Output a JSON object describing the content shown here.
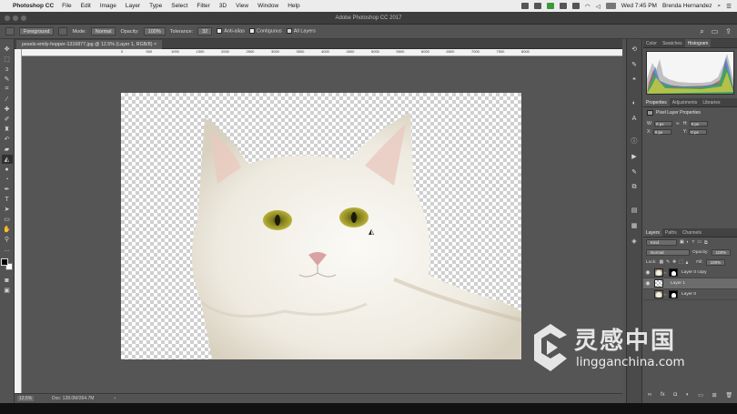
{
  "menubar": {
    "app_name": "Photoshop CC",
    "items": [
      "File",
      "Edit",
      "Image",
      "Layer",
      "Type",
      "Select",
      "Filter",
      "3D",
      "View",
      "Window",
      "Help"
    ],
    "clock": "Wed 7:45 PM",
    "user": "Brenda Hernandez"
  },
  "titlebar": {
    "title": "Adobe Photoshop CC 2017"
  },
  "options": {
    "source": "Foreground",
    "mode_label": "Mode:",
    "mode": "Normal",
    "opacity_label": "Opacity:",
    "opacity": "100%",
    "tolerance_label": "Tolerance:",
    "tolerance": "32",
    "antialias": "Anti-alias",
    "contiguous": "Contiguous",
    "all_layers": "All Layers"
  },
  "document": {
    "tab_title": "pexels-emily-hopper-1316877.jpg @ 12.5% (Layer 1, RGB/8)",
    "ruler_ticks": [
      "0",
      "500",
      "1000",
      "1500",
      "2000",
      "2500",
      "3000",
      "3500",
      "4000",
      "4500",
      "5000",
      "5500",
      "6000",
      "6500",
      "7000",
      "7500",
      "8000"
    ]
  },
  "status": {
    "zoom": "12.5%",
    "doc": "Doc: 128.0M/264.7M"
  },
  "panels": {
    "top_tabs": [
      "Color",
      "Swatches",
      "Histogram"
    ],
    "props_tabs": [
      "Properties",
      "Adjustments",
      "Libraries"
    ],
    "props_title": "Pixel Layer Properties",
    "w_label": "W:",
    "w": "0 px",
    "h_label": "H:",
    "h": "0 px",
    "x_label": "X:",
    "x": "0 px",
    "y_label": "Y:",
    "y": "0 px",
    "layers_tabs": [
      "Layers",
      "Paths",
      "Channels"
    ],
    "kind": "Kind",
    "blend": "Normal",
    "opacity_label": "Opacity:",
    "opacity": "100%",
    "lock_label": "Lock:",
    "fill_label": "Fill:",
    "fill": "100%",
    "layers": [
      {
        "name": "Layer 0 copy",
        "selected": false
      },
      {
        "name": "Layer 1",
        "selected": true
      },
      {
        "name": "Layer 0",
        "selected": false
      }
    ]
  },
  "watermark": {
    "cn": "灵感中国",
    "url": "lingganchina.com"
  }
}
